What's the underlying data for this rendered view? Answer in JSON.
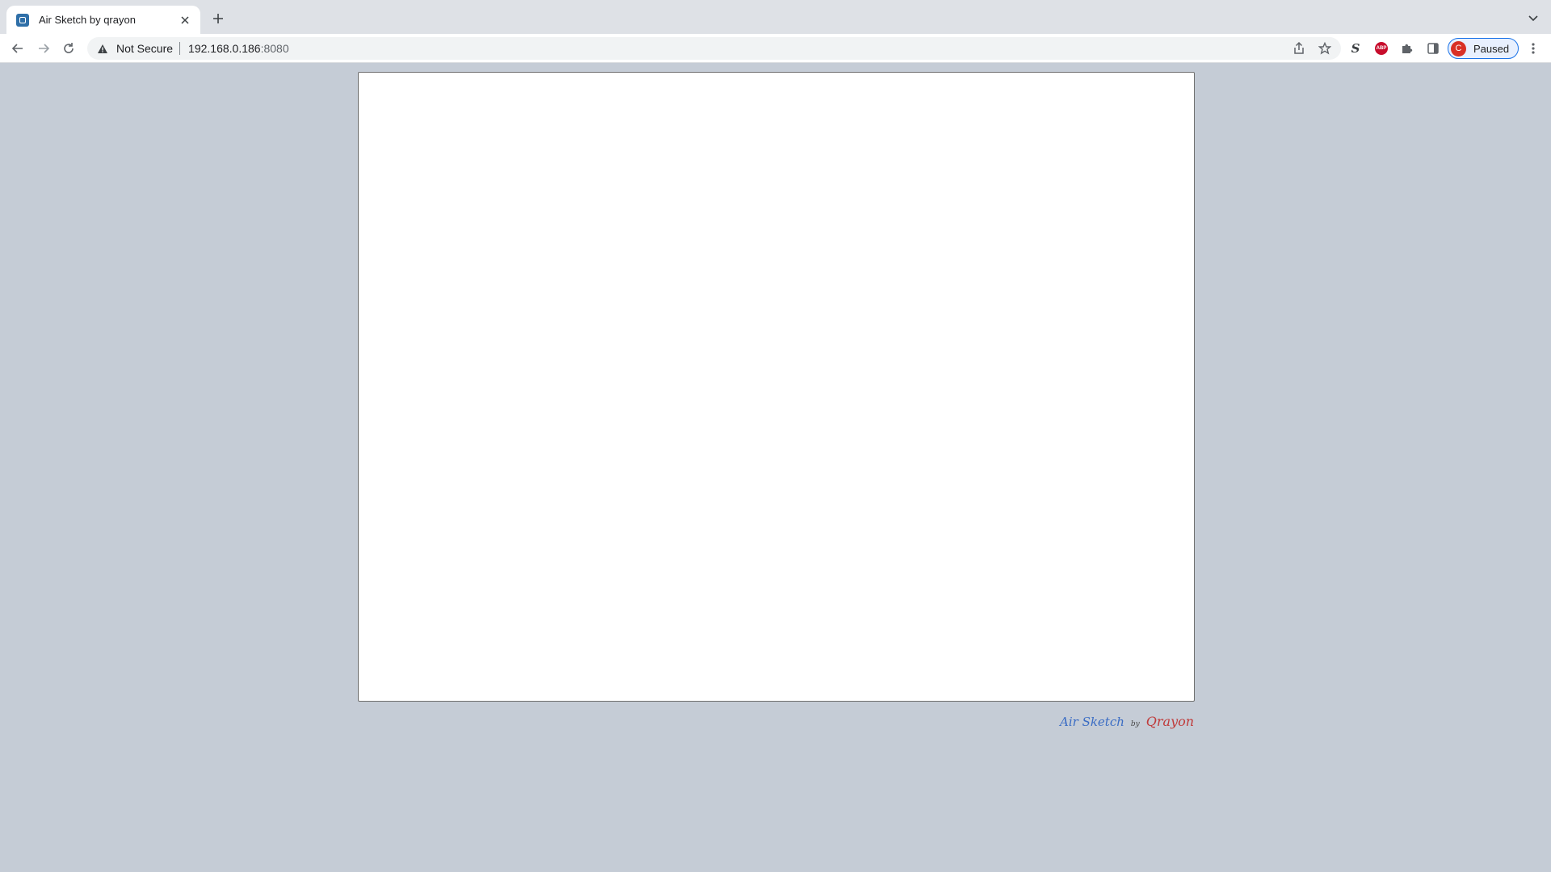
{
  "browser": {
    "tab": {
      "title": "Air Sketch by qrayon",
      "favicon": "air-sketch-favicon"
    },
    "address_bar": {
      "security_label": "Not Secure",
      "url_host": "192.168.0.186",
      "url_port": ":8080"
    },
    "extensions": {
      "s_label": "S",
      "abp_label": "ABP"
    },
    "profile": {
      "initial": "C",
      "status": "Paused"
    }
  },
  "page": {
    "footer_brand": {
      "app": "Air Sketch",
      "by": "by",
      "vendor": "Qrayon"
    }
  },
  "colors": {
    "page_background": "#c5ccd6",
    "canvas_background": "#ffffff",
    "accent": "#1a73e8"
  }
}
